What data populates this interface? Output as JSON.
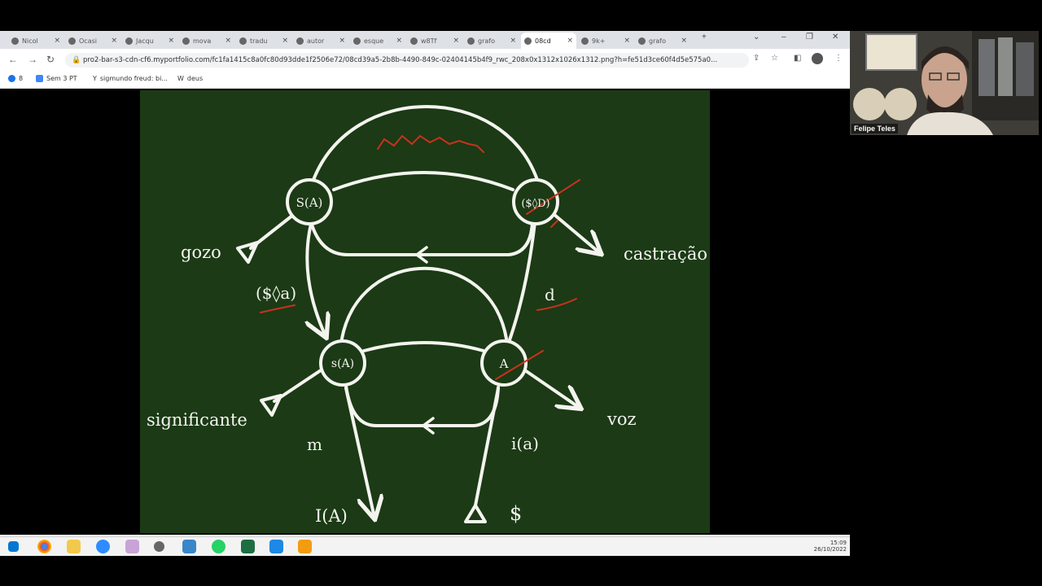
{
  "browser": {
    "tabs": [
      {
        "label": "Nicol"
      },
      {
        "label": "Ocasi"
      },
      {
        "label": "Jacqu"
      },
      {
        "label": "mova"
      },
      {
        "label": "tradu"
      },
      {
        "label": "autor"
      },
      {
        "label": "esque"
      },
      {
        "label": "w8Tf"
      },
      {
        "label": "grafo"
      },
      {
        "label": "08cd"
      },
      {
        "label": "9k+"
      },
      {
        "label": "grafo"
      }
    ],
    "active_tab_index": 9,
    "new_tab": "+",
    "url": "pro2-bar-s3-cdn-cf6.myportfolio.com/fc1fa1415c8a0fc80d93dde1f2506e72/08cd39a5-2b8b-4490-849c-02404145b4f9_rwc_208x0x1312x1026x1312.png?h=fe51d3ce60f4d5e575a0...",
    "bookmarks": [
      "8",
      "Sem 3 PT",
      "sigmundo freud: bi...",
      "deus"
    ]
  },
  "slide": {
    "labels": {
      "S_barred_A": "S(A)",
      "barred_S_D": "($◊D)",
      "gozo": "gozo",
      "castracao": "castração",
      "barred_S_a": "($◊a)",
      "d": "d",
      "s_A": "s(A)",
      "A": "A",
      "significante": "significante",
      "voz": "voz",
      "m": "m",
      "i_a": "i(a)",
      "I_A": "I(A)",
      "barred_S": "$"
    },
    "colors": {
      "background": "#1b3a15",
      "lines": "#f4f4ef",
      "annotation": "#c8321e"
    }
  },
  "taskbar": {
    "time": "15:09",
    "date": "26/10/2022"
  },
  "webcam": {
    "name": "Felipe Teles"
  }
}
